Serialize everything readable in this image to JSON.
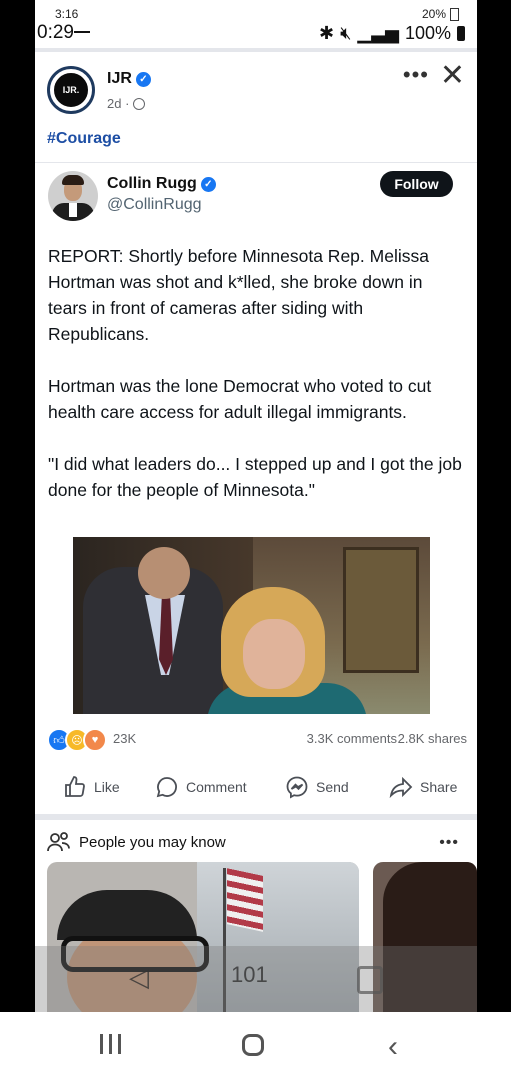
{
  "status_inner": {
    "time": "3:16",
    "battery": "20%"
  },
  "status_outer": {
    "time": "0:29",
    "battery": "100%"
  },
  "post": {
    "page_name": "IJR",
    "logo_text": "IJR.",
    "age": "2d ·",
    "hashtag": "#Courage"
  },
  "tweet": {
    "name": "Collin Rugg",
    "handle": "@CollinRugg",
    "follow_label": "Follow",
    "paragraphs": [
      "REPORT: Shortly before Minnesota Rep. Melissa Hortman was shot and k*lled, she broke down in tears in front of cameras after siding with Republicans.",
      "Hortman was the lone Democrat who voted to cut health care access for adult illegal immigrants.",
      "\"I did what leaders do... I stepped up and I got the job done for the people of Minnesota.\""
    ]
  },
  "engagement": {
    "reactions_count": "23K",
    "comments": "3.3K comments",
    "shares": "2.8K shares"
  },
  "actions": {
    "like": "Like",
    "comment": "Comment",
    "send": "Send",
    "share": "Share"
  },
  "pymk": {
    "title": "People you may know"
  },
  "overlay": {
    "home_label": "101"
  },
  "icons": [
    "ijr-logo-icon",
    "verified-icon",
    "globe-icon",
    "more-icon",
    "close-icon",
    "like-icon",
    "comment-icon",
    "messenger-icon",
    "share-icon",
    "people-icon",
    "recents-icon",
    "home-icon",
    "back-icon"
  ]
}
